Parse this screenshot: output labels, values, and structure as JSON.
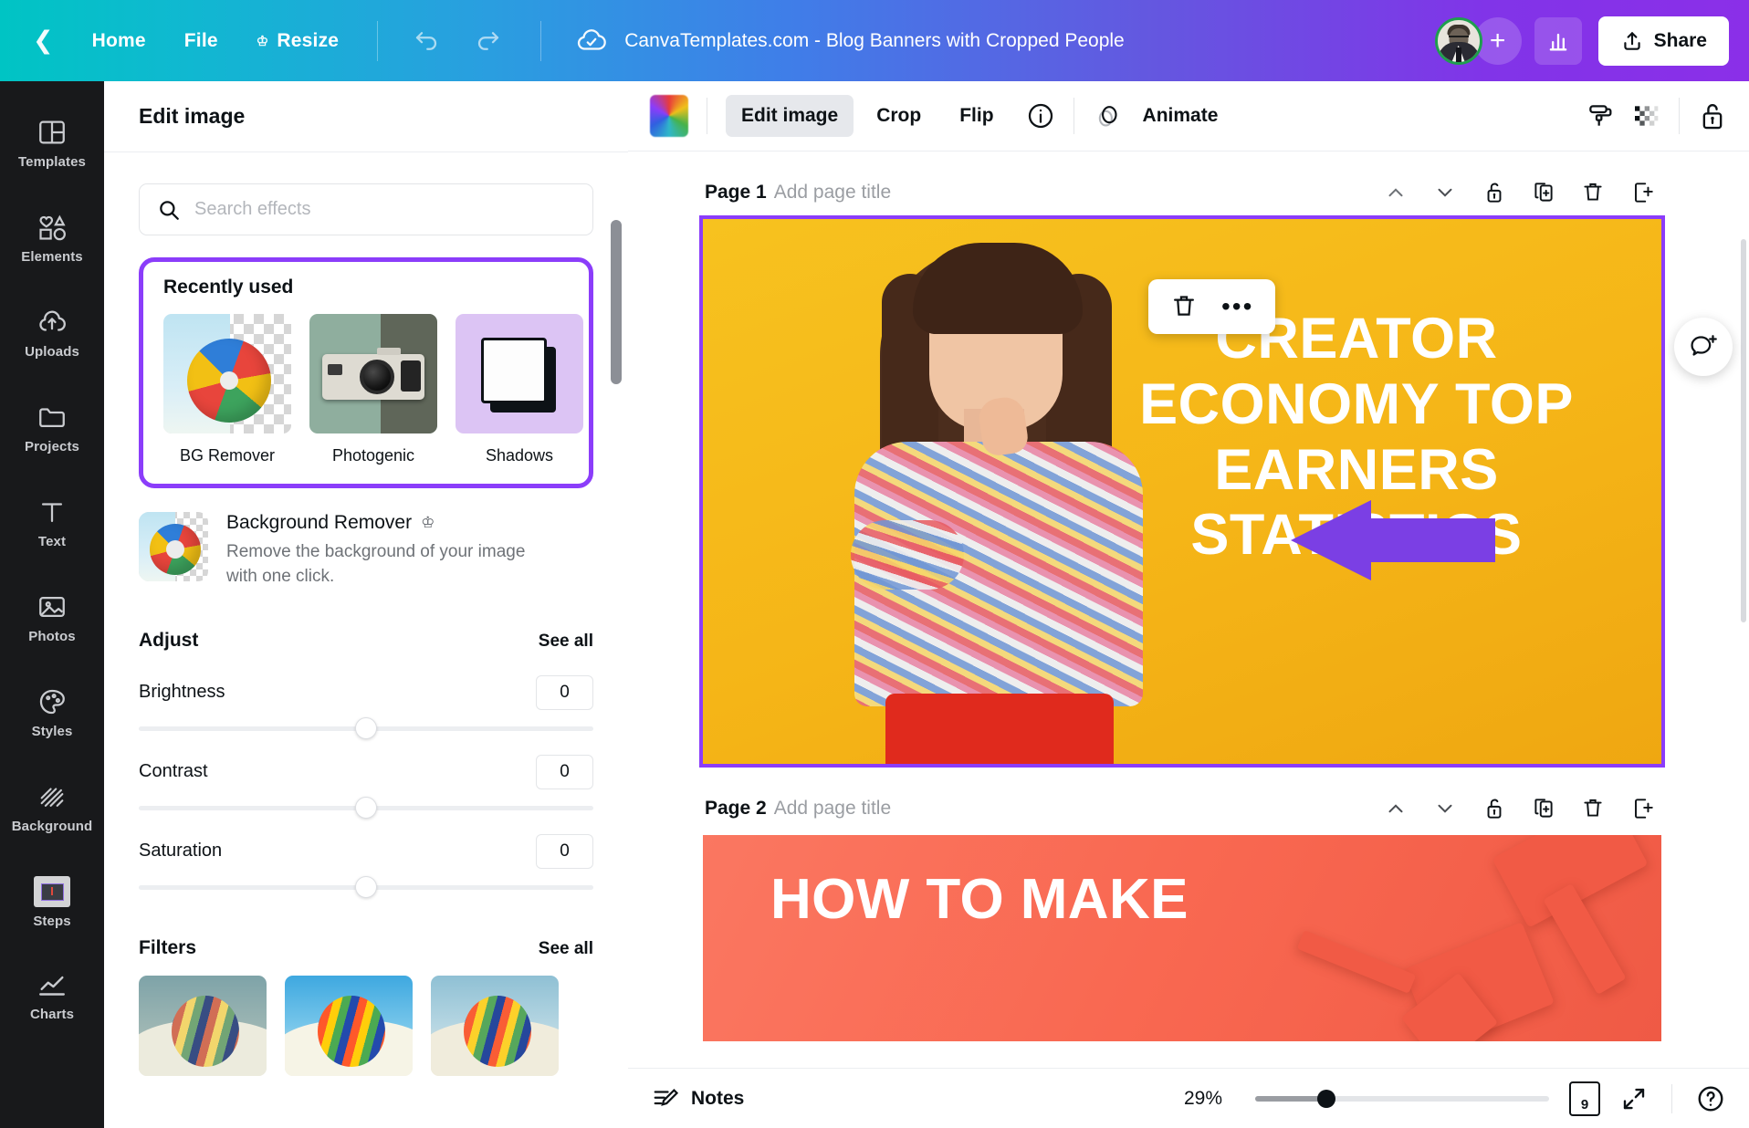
{
  "topbar": {
    "back_icon": "chevron-left-icon",
    "home": "Home",
    "file": "File",
    "resize": "Resize",
    "crown_icon": "crown-icon",
    "undo_icon": "undo-icon",
    "redo_icon": "redo-icon",
    "cloud_icon": "cloud-saved-icon",
    "doc_title": "CanvaTemplates.com - Blog Banners with Cropped People",
    "avatar": "user-avatar",
    "add_collaborator": "+",
    "insights_icon": "bar-chart-icon",
    "share_label": "Share",
    "share_icon": "share-upload-icon",
    "gradient_start": "#00c4c4",
    "gradient_end": "#8b2fe8"
  },
  "rail": {
    "items": [
      {
        "label": "Templates",
        "icon": "templates-icon"
      },
      {
        "label": "Elements",
        "icon": "elements-icon"
      },
      {
        "label": "Uploads",
        "icon": "uploads-cloud-icon"
      },
      {
        "label": "Projects",
        "icon": "folder-icon"
      },
      {
        "label": "Text",
        "icon": "text-t-icon"
      },
      {
        "label": "Photos",
        "icon": "photo-icon"
      },
      {
        "label": "Styles",
        "icon": "palette-icon"
      },
      {
        "label": "Background",
        "icon": "hatch-pattern-icon"
      },
      {
        "label": "Steps",
        "icon": "steps-thumbnail-icon"
      },
      {
        "label": "Charts",
        "icon": "line-chart-icon"
      }
    ]
  },
  "panel": {
    "title": "Edit image",
    "search": {
      "value": "",
      "placeholder": "Search effects",
      "icon": "search-icon"
    },
    "recently_used": {
      "title": "Recently used",
      "highlight_color": "#8b3dfa",
      "effects": [
        {
          "label": "BG Remover",
          "thumb": "beach-ball-transparent-thumb"
        },
        {
          "label": "Photogenic",
          "thumb": "camera-duotone-thumb"
        },
        {
          "label": "Shadows",
          "thumb": "shadow-card-thumb"
        }
      ]
    },
    "background_remover": {
      "title": "Background Remover",
      "pro_icon": "crown-icon",
      "description": "Remove the background of your image with one click.",
      "thumb": "beach-ball-transparent-thumb"
    },
    "adjust": {
      "title": "Adjust",
      "see_all": "See all",
      "sliders": [
        {
          "label": "Brightness",
          "value": "0"
        },
        {
          "label": "Contrast",
          "value": "0"
        },
        {
          "label": "Saturation",
          "value": "0"
        }
      ]
    },
    "filters": {
      "title": "Filters",
      "see_all": "See all",
      "items": [
        {
          "name": "filter-thumb-1"
        },
        {
          "name": "filter-thumb-2"
        },
        {
          "name": "filter-thumb-3"
        }
      ]
    }
  },
  "canvas_toolbar": {
    "swatch": "image-color-swatch",
    "edit_image": "Edit image",
    "crop": "Crop",
    "flip": "Flip",
    "info_icon": "info-circle-icon",
    "animate_icon": "animate-icon",
    "animate": "Animate",
    "paint_roller_icon": "paint-roller-icon",
    "transparency_icon": "transparency-icon",
    "lock_icon": "lock-open-icon"
  },
  "pages": [
    {
      "name": "Page 1",
      "subtitle": "Add page title",
      "actions": [
        "chevron-up-icon",
        "chevron-down-icon",
        "lock-icon",
        "duplicate-icon",
        "trash-icon",
        "add-page-icon"
      ],
      "headline": "CREATOR ECONOMY TOP EARNERS STATISTICS",
      "background_color": "#f5b81e",
      "selected": true,
      "float_toolbar": [
        "trash-icon",
        "more-options-icon"
      ]
    },
    {
      "name": "Page 2",
      "subtitle": "Add page title",
      "actions": [
        "chevron-up-icon",
        "chevron-down-icon",
        "lock-icon",
        "duplicate-icon",
        "trash-icon",
        "add-page-icon"
      ],
      "headline": "HOW TO MAKE",
      "background_color": "#f86b55",
      "selected": false
    }
  ],
  "annotation": {
    "arrow_color": "#7b3fe4",
    "shape": "left-arrow"
  },
  "comment_bubble": "add-comment-icon",
  "bottombar": {
    "notes_icon": "notes-icon",
    "notes": "Notes",
    "zoom": "29%",
    "page_count": "9",
    "pages_icon": "page-manager-icon",
    "fullscreen_icon": "fullscreen-icon",
    "help_icon": "help-circle-icon"
  },
  "canvas_nav": {
    "prev": "‹",
    "next": "›",
    "collapse": "˄"
  }
}
